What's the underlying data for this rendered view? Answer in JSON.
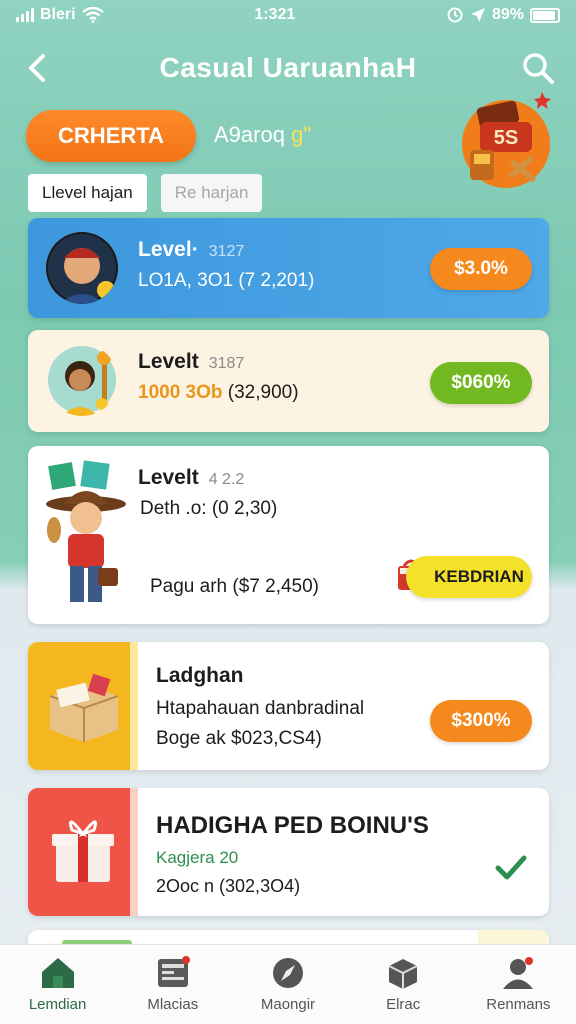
{
  "status_bar": {
    "carrier": "Bleri",
    "time": "1:321",
    "battery": "89%"
  },
  "header": {
    "title": "Casual UaruanhaH"
  },
  "promo": {
    "button_label": "CRHERTA",
    "subtitle_main": "A9aroq",
    "subtitle_accent": "g\"",
    "badge": "5S"
  },
  "filters": [
    {
      "label": "Llevel hajan"
    },
    {
      "label": "Re harjan"
    }
  ],
  "cards": [
    {
      "title": "Level·",
      "level_code": "3127",
      "line1": "LO1A, 3O1 (7 2,201)",
      "button": "$3.0%",
      "button_color": "#f5891e"
    },
    {
      "title": "Levelt",
      "level_code": "3187",
      "line1_accent": "1000 3Ob",
      "line1_rest": "(32,900)",
      "button": "$060%",
      "button_color": "#72b820"
    },
    {
      "title": "Levelt",
      "level_code": "4 2.2",
      "line1": "Deth .o: (0 2,30)",
      "line2": "Pagu arh ($7 2,450)",
      "button": "KEBDRIAN",
      "button_color": "#f4e12a"
    },
    {
      "title": "Ladghan",
      "line1": "Htapahauan danbradinal",
      "line2": "Boge ak $023,CS4)",
      "button": "$300%",
      "button_color": "#f5891e"
    },
    {
      "title": "HADIGHA PED BOINU'S",
      "line1": "Kagjera 20",
      "line2": "2Ooc n (302,3O4)"
    }
  ],
  "bottom_nav": [
    {
      "label": "Lemdian",
      "icon": "home-icon"
    },
    {
      "label": "Mlacias",
      "icon": "news-icon"
    },
    {
      "label": "Maongir",
      "icon": "compass-icon"
    },
    {
      "label": "Elrac",
      "icon": "box-icon"
    },
    {
      "label": "Renmans",
      "icon": "profile-icon"
    }
  ]
}
